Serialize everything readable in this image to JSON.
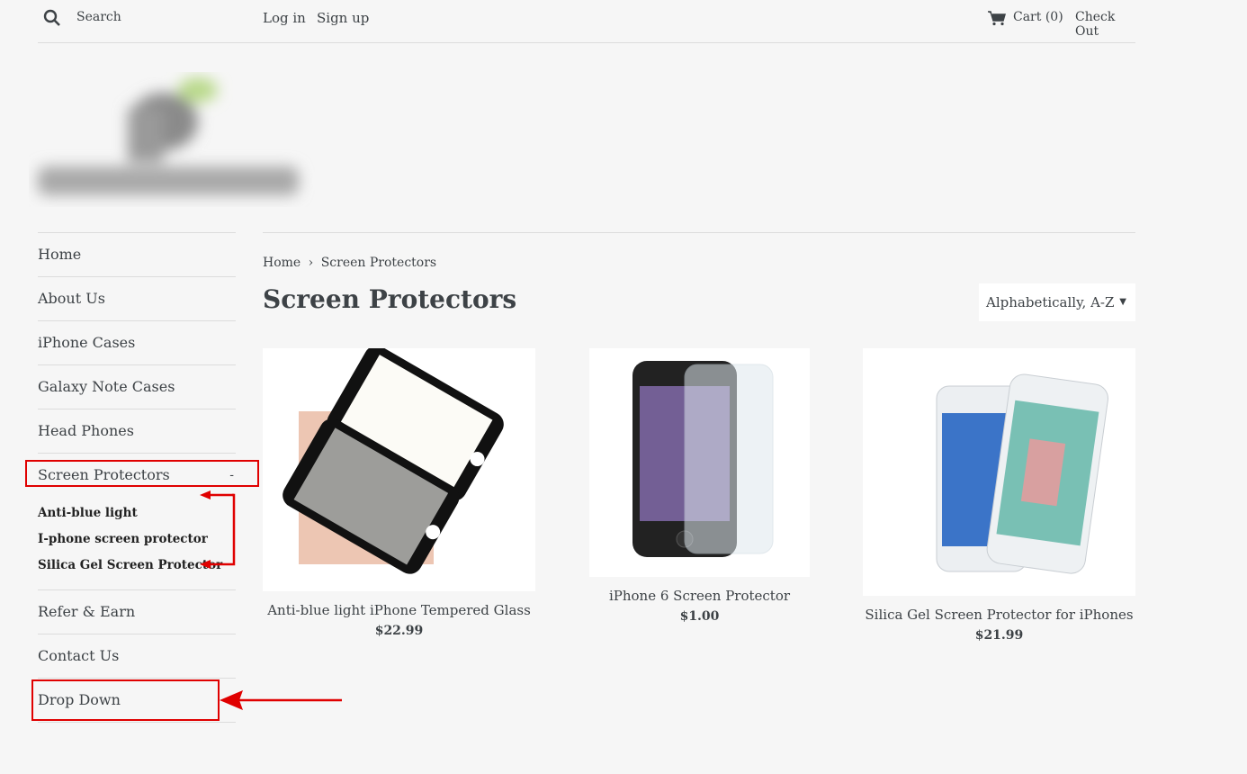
{
  "header": {
    "search_placeholder": "Search",
    "login": "Log in",
    "signup": "Sign up",
    "cart": "Cart (0)",
    "checkout": "Check Out"
  },
  "sidebar": {
    "items": [
      {
        "label": "Home"
      },
      {
        "label": "About Us"
      },
      {
        "label": "iPhone Cases"
      },
      {
        "label": "Galaxy Note Cases"
      },
      {
        "label": "Head Phones"
      },
      {
        "label": "Screen Protectors",
        "expanded_symbol": "-"
      }
    ],
    "subitems": [
      {
        "label": "Anti-blue light"
      },
      {
        "label": "I-phone screen protector"
      },
      {
        "label": "Silica Gel Screen Protector"
      }
    ],
    "bottom_items": [
      {
        "label": "Refer & Earn"
      },
      {
        "label": "Contact Us"
      },
      {
        "label": "Drop Down"
      }
    ]
  },
  "breadcrumb": {
    "home": "Home",
    "separator": "›",
    "current": "Screen Protectors"
  },
  "page_title": "Screen Protectors",
  "sort": {
    "selected": "Alphabetically, A-Z",
    "caret": "▼"
  },
  "products": [
    {
      "name": "Anti-blue light iPhone Tempered Glass",
      "price": "$22.99"
    },
    {
      "name": "iPhone 6 Screen Protector",
      "price": "$1.00"
    },
    {
      "name": "Silica Gel Screen Protector for iPhones",
      "price": "$21.99"
    }
  ],
  "colors": {
    "accent": "#3d4246",
    "annotation": "#e00000",
    "background": "#f6f6f6"
  }
}
